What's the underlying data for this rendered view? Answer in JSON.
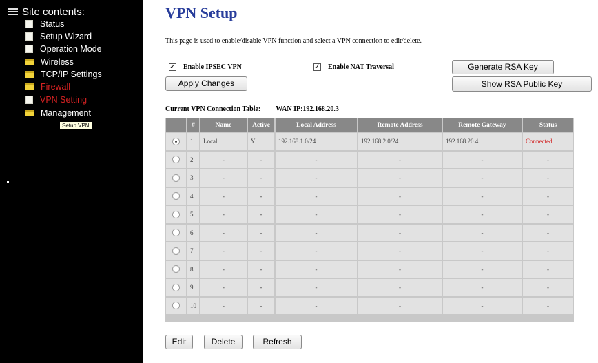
{
  "sidebar": {
    "root_label": "Site contents:",
    "items": [
      {
        "label": "Status",
        "icon": "page-icon"
      },
      {
        "label": "Setup Wizard",
        "icon": "page-icon"
      },
      {
        "label": "Operation Mode",
        "icon": "page-icon"
      },
      {
        "label": "Wireless",
        "icon": "folder-icon"
      },
      {
        "label": "TCP/IP Settings",
        "icon": "folder-icon"
      },
      {
        "label": "Firewall",
        "icon": "folder-icon"
      },
      {
        "label": "VPN Setting",
        "icon": "page-icon"
      },
      {
        "label": "Management",
        "icon": "folder-icon"
      }
    ],
    "tooltip": "Setup VPN"
  },
  "page": {
    "title": "VPN Setup",
    "description": "This page is used to enable/disable VPN function and select a VPN connection to edit/delete."
  },
  "options": {
    "enable_ipsec_label": "Enable IPSEC VPN",
    "enable_ipsec_checked": true,
    "enable_nat_label": "Enable NAT Traversal",
    "enable_nat_checked": true,
    "check_mark": "✓"
  },
  "buttons": {
    "generate_rsa": "Generate RSA Key",
    "apply": "Apply Changes",
    "show_rsa": "Show RSA Public Key",
    "edit": "Edit",
    "delete": "Delete",
    "refresh": "Refresh"
  },
  "table": {
    "caption": "Current VPN Connection Table:",
    "wan_ip": "WAN IP:192.168.20.3",
    "headers": [
      "",
      "#",
      "Name",
      "Active",
      "Local Address",
      "Remote Address",
      "Remote Gateway",
      "Status"
    ],
    "rows": [
      {
        "selected": true,
        "num": "1",
        "name": "Local",
        "active": "Y",
        "local": "192.168.1.0/24",
        "remote": "192.168.2.0/24",
        "gateway": "192.168.20.4",
        "status": "Connected"
      },
      {
        "selected": false,
        "num": "2",
        "name": "-",
        "active": "-",
        "local": "-",
        "remote": "-",
        "gateway": "-",
        "status": "-"
      },
      {
        "selected": false,
        "num": "3",
        "name": "-",
        "active": "-",
        "local": "-",
        "remote": "-",
        "gateway": "-",
        "status": "-"
      },
      {
        "selected": false,
        "num": "4",
        "name": "-",
        "active": "-",
        "local": "-",
        "remote": "-",
        "gateway": "-",
        "status": "-"
      },
      {
        "selected": false,
        "num": "5",
        "name": "-",
        "active": "-",
        "local": "-",
        "remote": "-",
        "gateway": "-",
        "status": "-"
      },
      {
        "selected": false,
        "num": "6",
        "name": "-",
        "active": "-",
        "local": "-",
        "remote": "-",
        "gateway": "-",
        "status": "-"
      },
      {
        "selected": false,
        "num": "7",
        "name": "-",
        "active": "-",
        "local": "-",
        "remote": "-",
        "gateway": "-",
        "status": "-"
      },
      {
        "selected": false,
        "num": "8",
        "name": "-",
        "active": "-",
        "local": "-",
        "remote": "-",
        "gateway": "-",
        "status": "-"
      },
      {
        "selected": false,
        "num": "9",
        "name": "-",
        "active": "-",
        "local": "-",
        "remote": "-",
        "gateway": "-",
        "status": "-"
      },
      {
        "selected": false,
        "num": "10",
        "name": "-",
        "active": "-",
        "local": "-",
        "remote": "-",
        "gateway": "-",
        "status": "-"
      }
    ]
  },
  "colors": {
    "title": "#273c9b",
    "status_connected": "#d22222",
    "nav_active": "#d62222"
  }
}
